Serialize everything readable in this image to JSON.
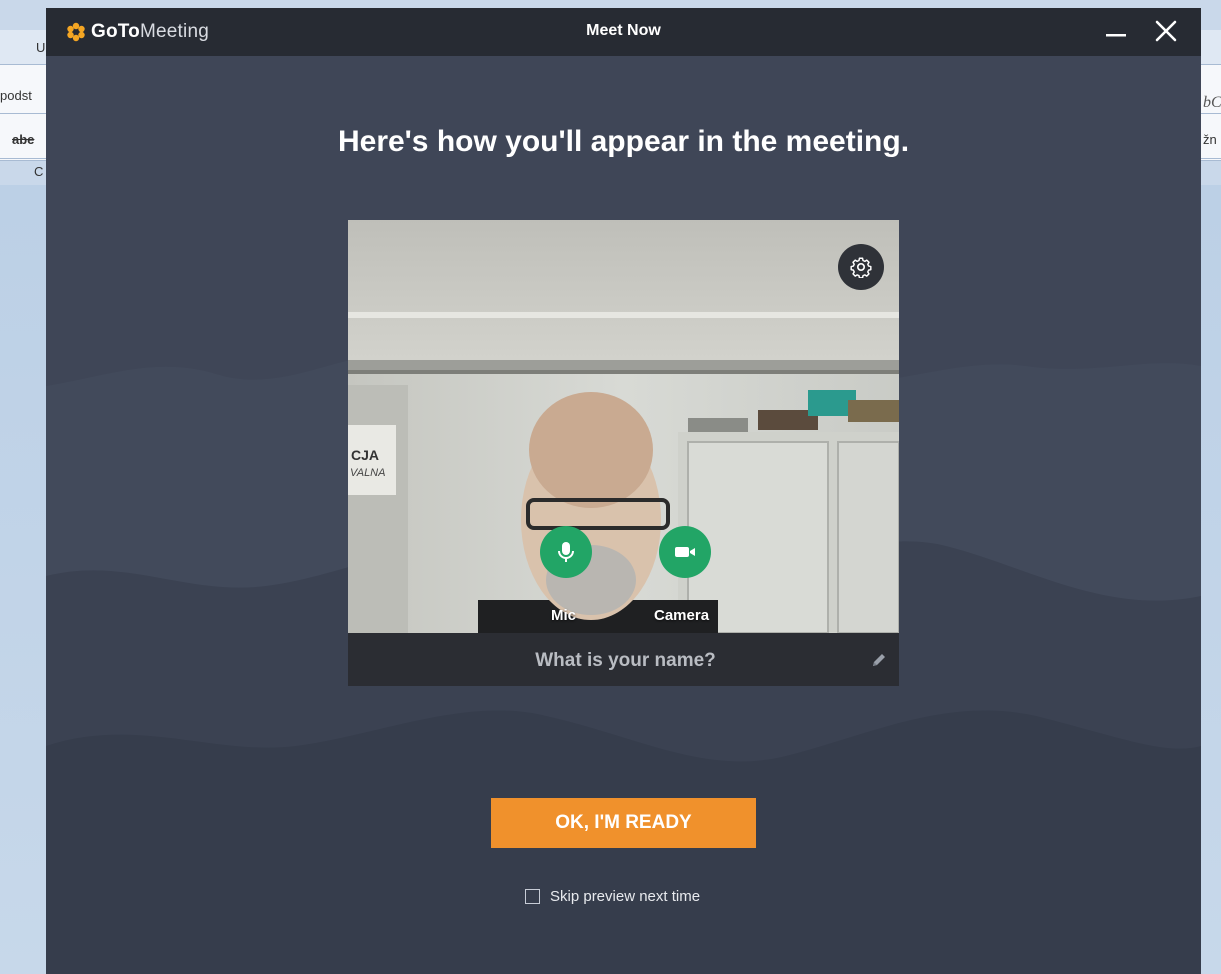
{
  "background_app": {
    "fragments": {
      "f1": "U",
      "f2": "podst",
      "f3": "abe",
      "f4": "C",
      "f5": "bC",
      "f6": "žn"
    }
  },
  "window": {
    "logo": {
      "bold": "GoTo",
      "light": "Meeting"
    },
    "title": "Meet Now",
    "minimize_icon": "minimize-icon",
    "close_icon": "close-icon"
  },
  "headline": "Here's how you'll appear in the meeting.",
  "preview": {
    "settings_icon": "gear-icon",
    "mic_label": "Mic",
    "camera_label": "Camera",
    "name_placeholder": "What is your name?",
    "name_value": "",
    "edit_icon": "pencil-icon"
  },
  "ready_button": "OK, I'M READY",
  "skip_preview": {
    "label": "Skip preview next time",
    "checked": false
  },
  "colors": {
    "window_bg": "#3f4657",
    "titlebar_bg": "#272b33",
    "accent": "#f0912c",
    "control_green": "#22a566"
  }
}
